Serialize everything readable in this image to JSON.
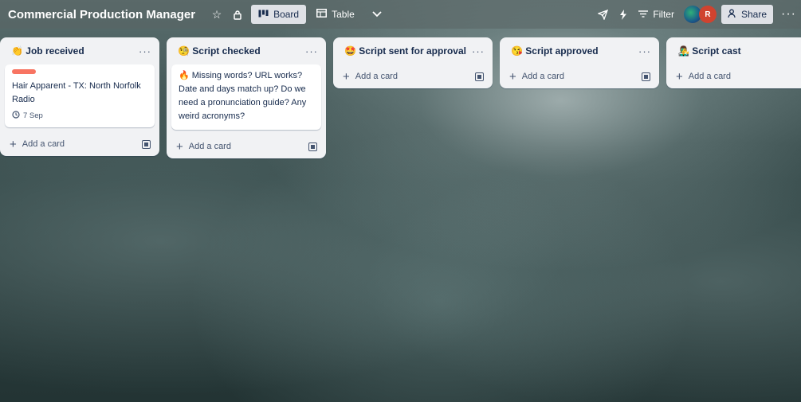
{
  "board": {
    "title": "Commercial Production Manager"
  },
  "views": [
    {
      "label": "Board",
      "icon": "board-icon"
    },
    {
      "label": "Table",
      "icon": "table-icon"
    }
  ],
  "header_actions": {
    "filter_label": "Filter",
    "share_label": "Share",
    "avatar_initial": "R"
  },
  "lists": [
    {
      "title": "👏 Job received",
      "cards": [
        {
          "label_color": "#f87462",
          "title": "Hair Apparent - TX: North Norfolk Radio",
          "date": "7 Sep"
        }
      ],
      "add_label": "Add a card"
    },
    {
      "title": "🧐 Script checked",
      "cards": [
        {
          "title": "🔥 Missing words? URL works? Date and days match up? Do we need a pronunciation guide? Any weird acronyms?"
        }
      ],
      "add_label": "Add a card"
    },
    {
      "title": "🤩 Script sent for approval",
      "cards": [],
      "add_label": "Add a card"
    },
    {
      "title": "😘 Script approved",
      "cards": [],
      "add_label": "Add a card"
    },
    {
      "title": "👨‍🎤 Script cast",
      "cards": [],
      "add_label": "Add a card"
    }
  ],
  "colors": {
    "accent": "#f87462",
    "list_bg": "#f1f2f4",
    "text": "#172b4d"
  }
}
